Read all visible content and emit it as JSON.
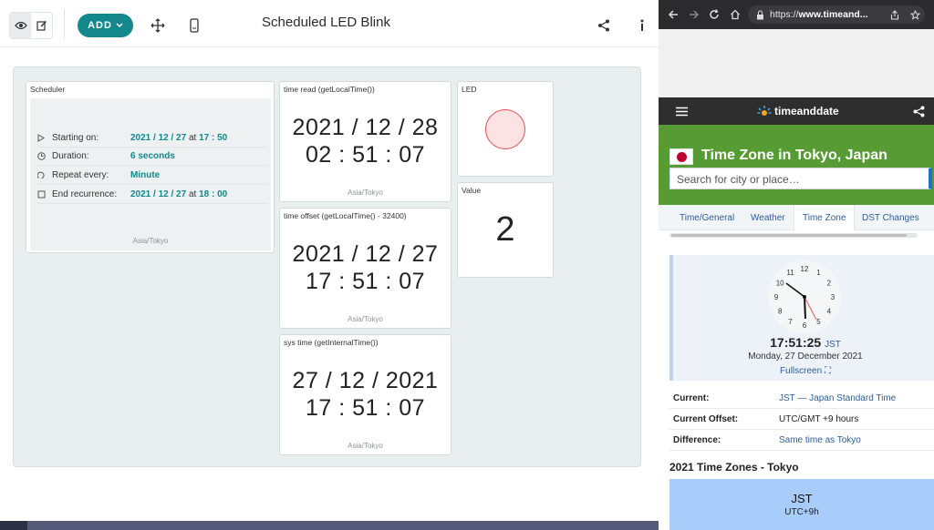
{
  "app": {
    "title": "Scheduled LED Blink",
    "add_label": "ADD",
    "icons": [
      "eye-icon",
      "edit-icon",
      "move-icon",
      "mobile-icon",
      "share-icon",
      "info-icon"
    ],
    "accent": "#12888d"
  },
  "widgets": {
    "scheduler": {
      "title": "Scheduler",
      "rows": [
        {
          "icon": "play-icon",
          "label": "Starting on:",
          "date": "2021 / 12 / 27",
          "at": "at",
          "time": "17 : 50"
        },
        {
          "icon": "clock-icon",
          "label": "Duration:",
          "value": "6 seconds"
        },
        {
          "icon": "repeat-icon",
          "label": "Repeat every:",
          "value": "Minute"
        },
        {
          "icon": "checkbox-icon",
          "label": "End recurrence:",
          "date": "2021 / 12 / 27",
          "at": "at",
          "time": "18 : 00"
        }
      ],
      "tz": "Asia/Tokyo"
    },
    "time_read": {
      "title": "time read (getLocalTime())",
      "line1": "2021 / 12 / 28",
      "line2": "02 : 51 : 07",
      "tz": "Asia/Tokyo"
    },
    "time_offset": {
      "title": "time offset (getLocalTime() - 32400)",
      "line1": "2021 / 12 / 27",
      "line2": "17 : 51 : 07",
      "tz": "Asia/Tokyo"
    },
    "sys_time": {
      "title": "sys time (getInternalTime())",
      "line1": "27 / 12 / 2021",
      "line2": "17 : 51 : 07",
      "tz": "Asia/Tokyo"
    },
    "led": {
      "title": "LED",
      "color": "#e05050"
    },
    "value": {
      "title": "Value",
      "number": "2"
    }
  },
  "browser": {
    "url_prefix": "https://",
    "url_host": "www.timeand...",
    "logo_text": "timeanddate",
    "page_title": "Time Zone in Tokyo, Japan",
    "search_placeholder": "Search for city or place…",
    "tabs": [
      "Time/General",
      "Weather",
      "Time Zone",
      "DST Changes"
    ],
    "active_tab": "Time Zone",
    "clock_numbers": [
      "12",
      "1",
      "2",
      "3",
      "4",
      "5",
      "6",
      "7",
      "8",
      "9",
      "10",
      "11"
    ],
    "clock_time": "17:51:25",
    "clock_tz": "JST",
    "clock_date": "Monday, 27 December 2021",
    "fullscreen_label": "Fullscreen",
    "info": [
      {
        "key": "Current:",
        "value": "JST — Japan Standard Time"
      },
      {
        "key": "Current Offset:",
        "value": "UTC/GMT +9 hours"
      },
      {
        "key": "Difference:",
        "value": "Same time as Tokyo"
      }
    ],
    "section_title": "2021 Time Zones - Tokyo",
    "zone_box": {
      "name": "JST",
      "offset": "UTC+9h"
    },
    "green": "#569b34"
  }
}
